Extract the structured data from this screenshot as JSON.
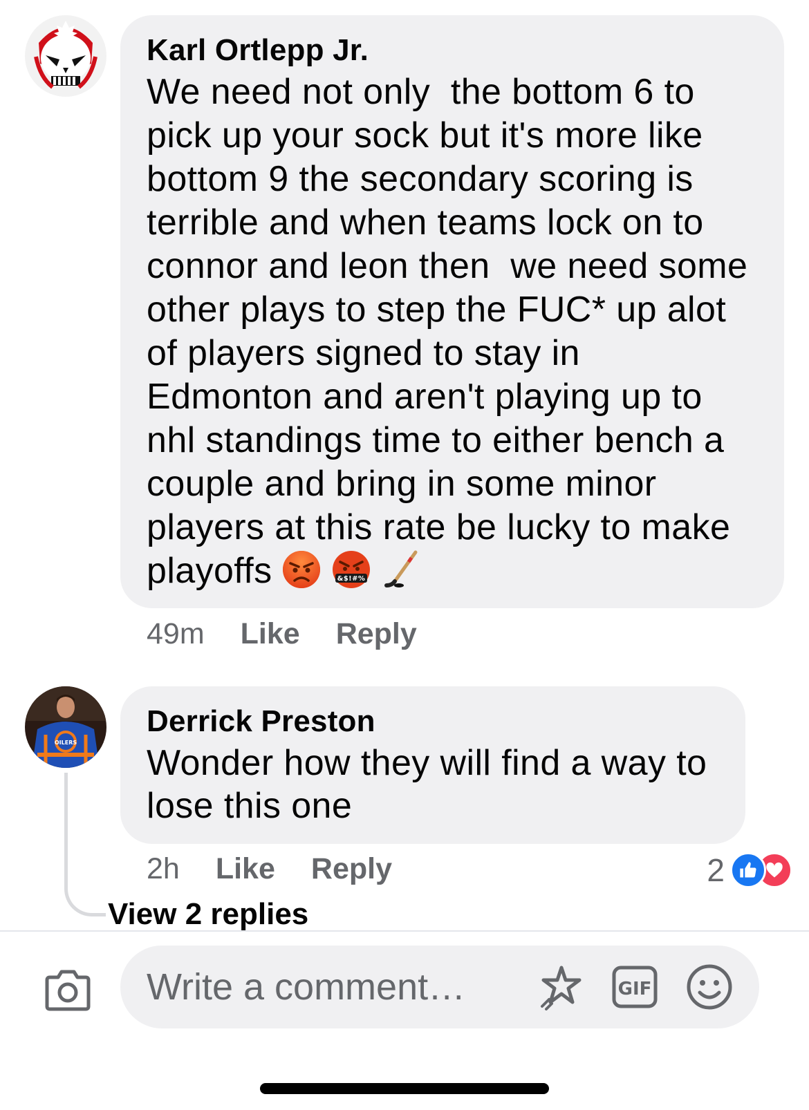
{
  "comments": [
    {
      "author": "Karl Ortlepp Jr.",
      "text": "We need not only  the bottom 6 to\npick up your sock but it's more like\nbottom 9 the secondary scoring is\nterrible and when teams lock on to\nconnor and leon then  we need some\nother plays to step the FUC* up alot\nof players signed to stay in\nEdmonton and aren't playing up to\nnhl standings time to either bench a\ncouple and bring in some minor\nplayers at this rate be lucky to make\nplayoffs",
      "emojis": [
        "angry-face",
        "swearing-face",
        "hockey-stick"
      ],
      "time": "49m",
      "like_label": "Like",
      "reply_label": "Reply"
    },
    {
      "author": "Derrick Preston",
      "text": "Wonder how they will find a way to\nlose this one",
      "time": "2h",
      "like_label": "Like",
      "reply_label": "Reply",
      "reaction_count": "2",
      "reactions": [
        "like",
        "love"
      ],
      "view_replies": "View 2 replies"
    }
  ],
  "composer": {
    "placeholder": "Write a comment…",
    "icons": [
      "camera-icon",
      "sticker-icon",
      "gif-icon",
      "emoji-icon"
    ],
    "gif_label": "GIF"
  },
  "colors": {
    "bubble": "#f0f0f2",
    "meta_text": "#65676b",
    "like_blue": "#1877f2",
    "love_red": "#f33e58"
  }
}
